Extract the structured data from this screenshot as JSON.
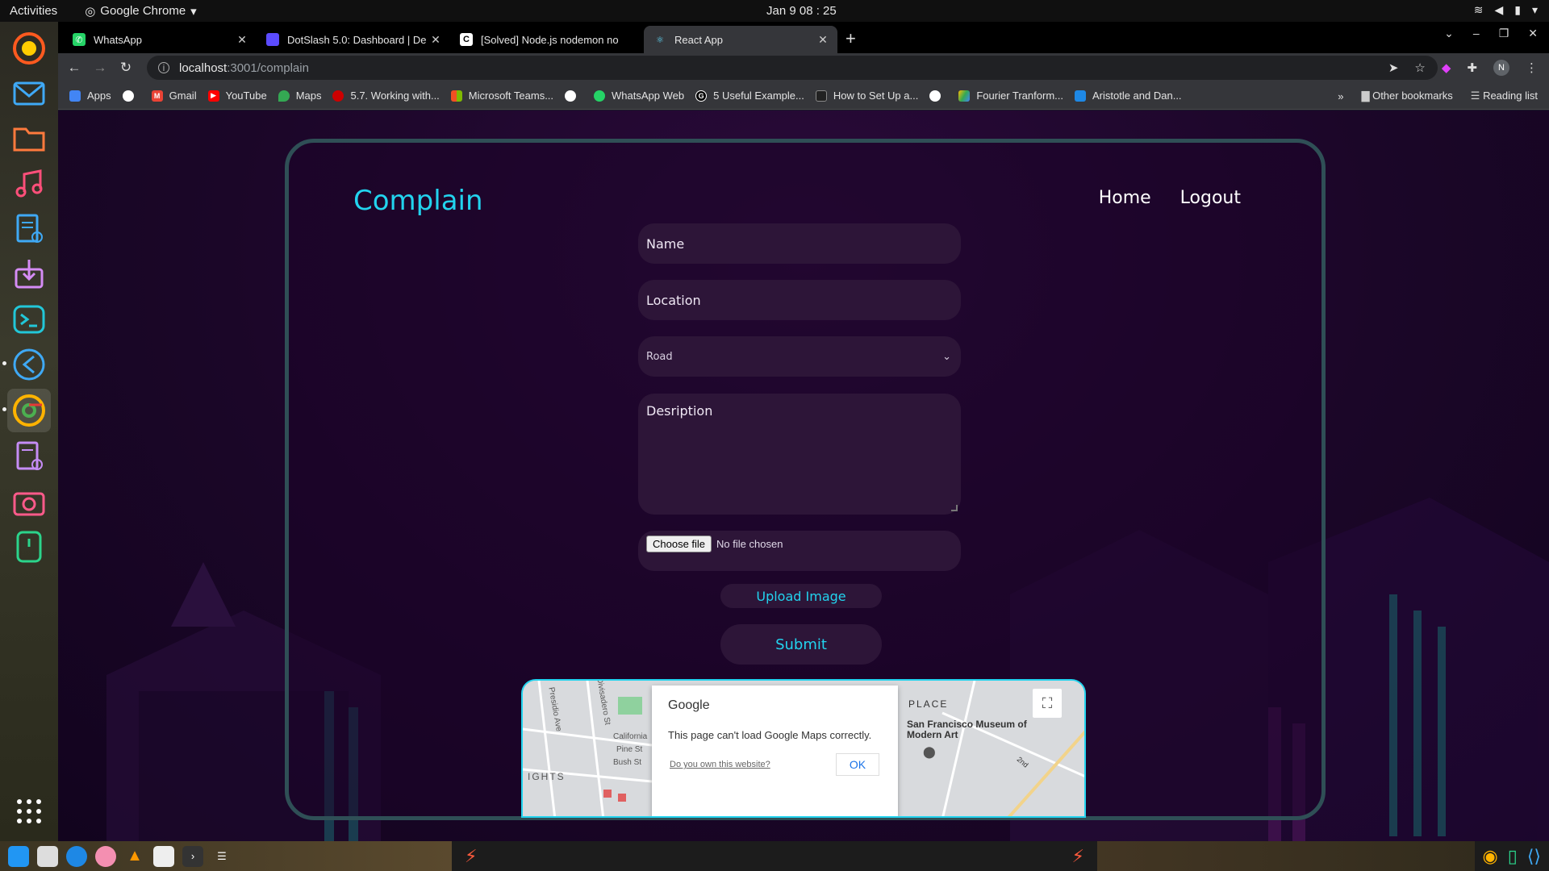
{
  "topbar": {
    "activities": "Activities",
    "app_name": "Google Chrome",
    "clock": "Jan 9  08 : 25"
  },
  "tabs": [
    {
      "title": "WhatsApp",
      "close": "✕"
    },
    {
      "title": "DotSlash 5.0: Dashboard | De",
      "close": "✕"
    },
    {
      "title": "[Solved] Node.js nodemon no",
      "close": "✕"
    },
    {
      "title": "React App",
      "close": "✕"
    }
  ],
  "omnibox": {
    "host": "localhost",
    "path": ":3001/complain"
  },
  "avatar_letter": "N",
  "bookmarks": [
    {
      "label": "Apps"
    },
    {
      "label": ""
    },
    {
      "label": "Gmail"
    },
    {
      "label": "YouTube"
    },
    {
      "label": "Maps"
    },
    {
      "label": "5.7. Working with..."
    },
    {
      "label": "Microsoft Teams..."
    },
    {
      "label": ""
    },
    {
      "label": "WhatsApp Web"
    },
    {
      "label": "5 Useful Example..."
    },
    {
      "label": "How to Set Up a..."
    },
    {
      "label": ""
    },
    {
      "label": "Fourier Tranform..."
    },
    {
      "label": "Aristotle and Dan..."
    }
  ],
  "bookmarks_right": {
    "more": "»",
    "other": "Other bookmarks",
    "reading": "Reading list"
  },
  "page": {
    "brand": "Complain",
    "nav": {
      "home": "Home",
      "logout": "Logout"
    },
    "form": {
      "name_placeholder": "Name",
      "location_placeholder": "Location",
      "category_selected": "Road",
      "description_placeholder": "Desription",
      "choose_file": "Choose file",
      "no_file": "No file chosen",
      "upload_label": "Upload Image",
      "submit_label": "Submit"
    },
    "map": {
      "dialog_brand": "Google",
      "dialog_message": "This page can't load Google Maps correctly.",
      "dialog_link": "Do you own this website?",
      "dialog_ok": "OK",
      "place_label": "PLACE",
      "museum_label": "San Francisco Museum of Modern Art",
      "streets": [
        "Presidio Ave",
        "Divisadero St",
        "California",
        "Pine St",
        "Bush St",
        "IGHTS"
      ],
      "street_corner": "2nd"
    }
  },
  "colors": {
    "accent": "#22d3ee",
    "field_bg": "#2d1538",
    "card_border": "#2f4f56",
    "page_bg": "#1b0628"
  }
}
